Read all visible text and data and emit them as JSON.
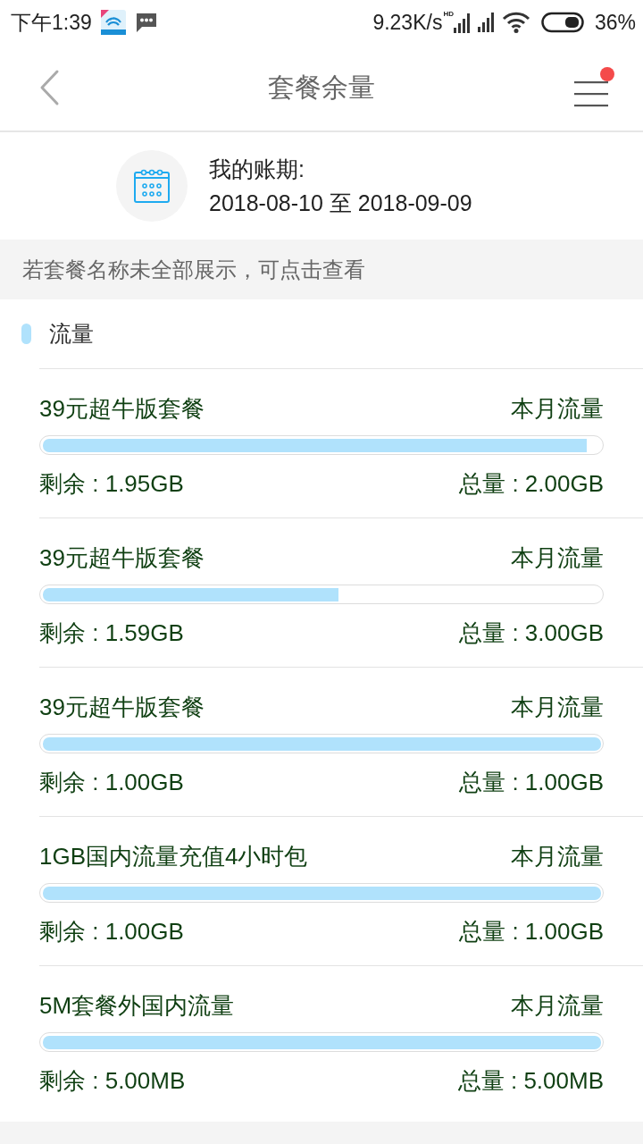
{
  "status_bar": {
    "time": "下午1:39",
    "net_speed": "9.23K/s",
    "network_badge": "HD",
    "battery": "36%"
  },
  "header": {
    "title": "套餐余量",
    "menu_badge": true
  },
  "billing": {
    "label": "我的账期:",
    "period": "2018-08-10 至 2018-09-09"
  },
  "notice": {
    "text": "若套餐名称未全部展示，可点击查看"
  },
  "usage": {
    "title": "流量",
    "items": [
      {
        "name": "39元超牛版套餐",
        "period": "本月流量",
        "level": 0.975,
        "remaining": "剩余 : 1.95GB",
        "total": "总量 : 2.00GB"
      },
      {
        "name": "39元超牛版套餐",
        "period": "本月流量",
        "level": 0.53,
        "remaining": "剩余 : 1.59GB",
        "total": "总量 : 3.00GB"
      },
      {
        "name": "39元超牛版套餐",
        "period": "本月流量",
        "level": 1,
        "remaining": "剩余 : 1.00GB",
        "total": "总量 : 1.00GB"
      },
      {
        "name": "1GB国内流量充值4小时包",
        "period": "本月流量",
        "level": 1,
        "remaining": "剩余 : 1.00GB",
        "total": "总量 : 1.00GB"
      },
      {
        "name": "5M套餐外国内流量",
        "period": "本月流量",
        "level": 1,
        "remaining": "剩余 : 5.00MB",
        "total": "总量 : 5.00MB"
      }
    ]
  }
}
